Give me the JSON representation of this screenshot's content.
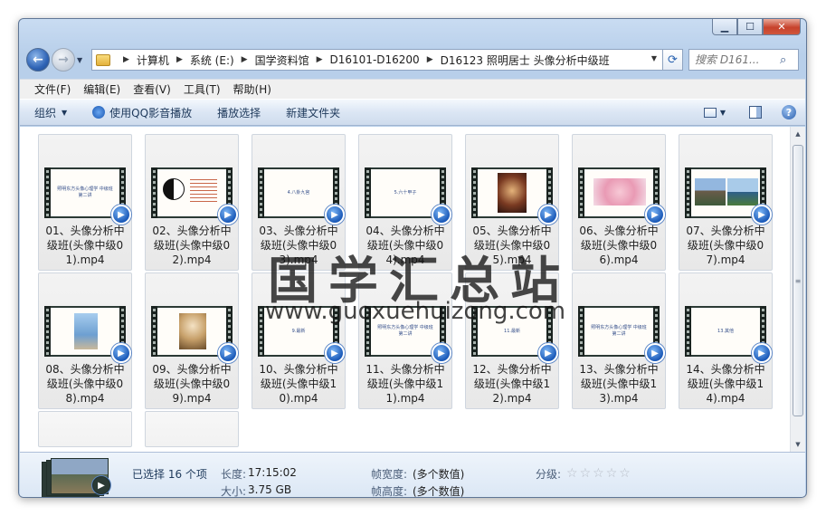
{
  "window": {
    "caption": {
      "minimize": "▁",
      "maximize": "☐",
      "close": "✕"
    }
  },
  "address_bar": {
    "breadcrumbs": [
      "计算机",
      "系统 (E:)",
      "国学资料馆",
      "D16101-D16200",
      "D16123 照明居士 头像分析中级班"
    ],
    "search_placeholder": "搜索 D161..."
  },
  "menu": [
    "文件(F)",
    "编辑(E)",
    "查看(V)",
    "工具(T)",
    "帮助(H)"
  ],
  "command_bar": {
    "organize": "组织",
    "play_qq": "使用QQ影音播放",
    "play_selection": "播放选择",
    "new_folder": "新建文件夹"
  },
  "files": [
    {
      "name": "01、头像分析中级班(头像中级01).mp4",
      "slide": "照明东方头像心理学 中级班 第二讲"
    },
    {
      "name": "02、头像分析中级班(头像中级02).mp4",
      "slide": ""
    },
    {
      "name": "03、头像分析中级班(头像中级03).mp4",
      "slide": "4.八卦九宫"
    },
    {
      "name": "04、头像分析中级班(头像中级04).mp4",
      "slide": "5.六十甲子"
    },
    {
      "name": "05、头像分析中级班(头像中级05).mp4",
      "slide": ""
    },
    {
      "name": "06、头像分析中级班(头像中级06).mp4",
      "slide": ""
    },
    {
      "name": "07、头像分析中级班(头像中级07).mp4",
      "slide": ""
    },
    {
      "name": "08、头像分析中级班(头像中级08).mp4",
      "slide": ""
    },
    {
      "name": "09、头像分析中级班(头像中级09).mp4",
      "slide": ""
    },
    {
      "name": "10、头像分析中级班(头像中级10).mp4",
      "slide": "9.最新"
    },
    {
      "name": "11、头像分析中级班(头像中级11).mp4",
      "slide": "照明东方头像心理学 中级班 第二讲"
    },
    {
      "name": "12、头像分析中级班(头像中级12).mp4",
      "slide": "11.最新"
    },
    {
      "name": "13、头像分析中级班(头像中级13).mp4",
      "slide": "照明东方头像心理学 中级班 第二讲"
    },
    {
      "name": "14、头像分析中级班(头像中级14).mp4",
      "slide": "13.其他"
    }
  ],
  "watermark": {
    "title": "国学汇总站",
    "url": "www.guoxuehuizong.com"
  },
  "details": {
    "selected": "已选择 16 个项",
    "length_label": "长度:",
    "length_value": "17:15:02",
    "size_label": "大小:",
    "size_value": "3.75 GB",
    "frame_width_label": "帧宽度:",
    "frame_width_value": "(多个数值)",
    "frame_height_label": "帧高度:",
    "frame_height_value": "(多个数值)",
    "rating_label": "分级:",
    "rating": 0
  }
}
